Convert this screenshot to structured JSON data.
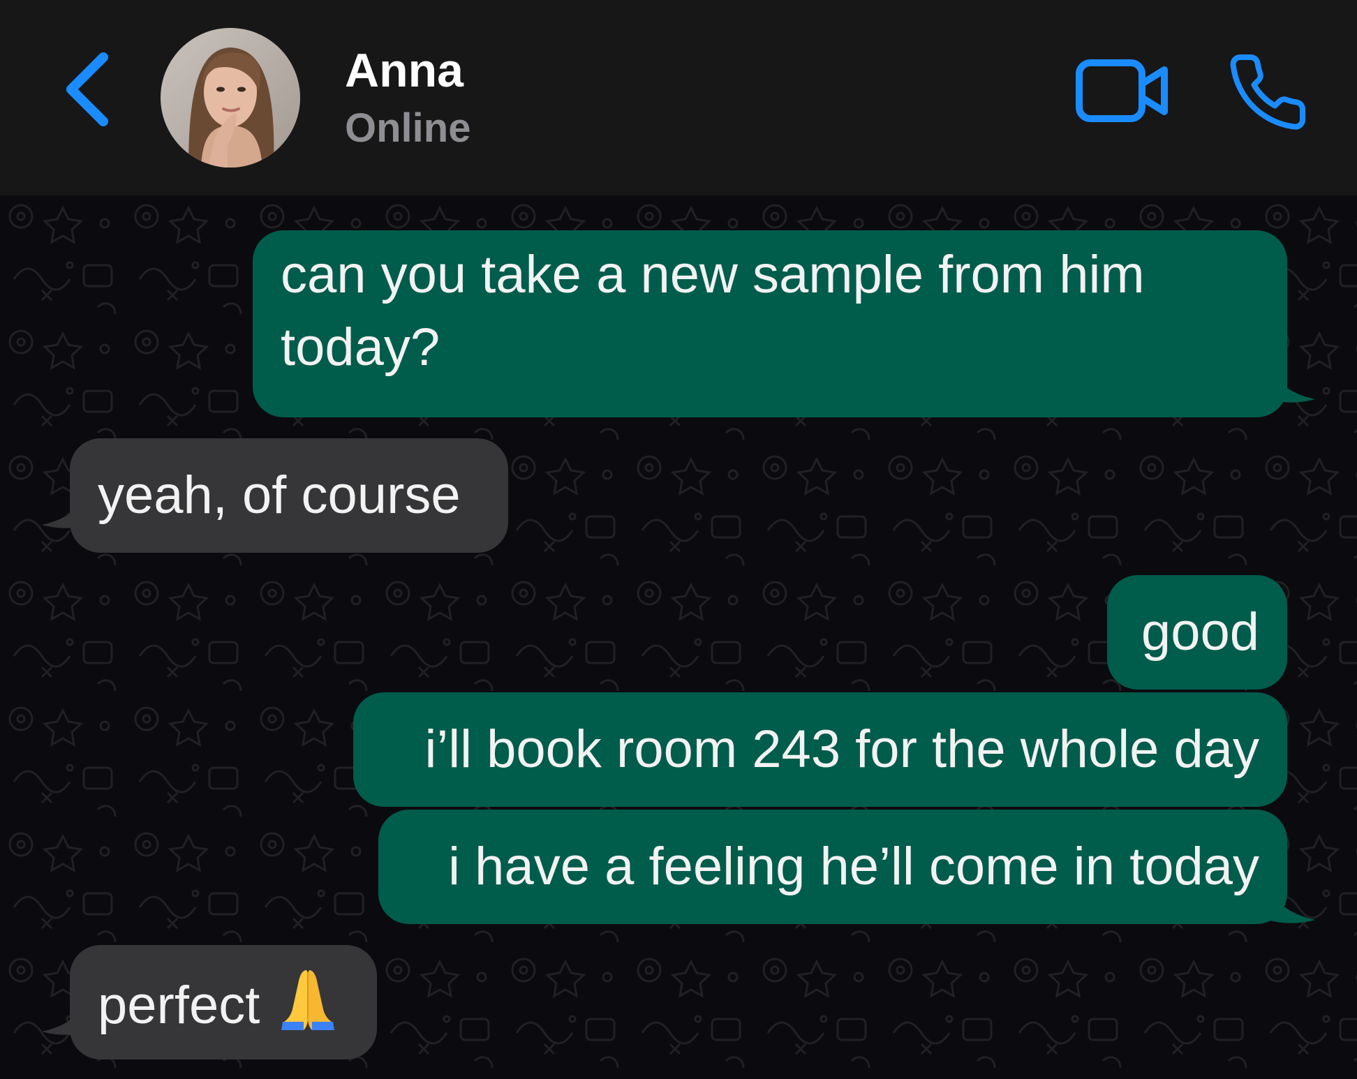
{
  "header": {
    "contact_name": "Anna",
    "status": "Online",
    "back_icon": "chevron-left-icon",
    "video_icon": "video-camera-icon",
    "call_icon": "phone-icon"
  },
  "colors": {
    "header_bg": "#171717",
    "accent": "#1a8cff",
    "outgoing_bubble": "#005c4b",
    "incoming_bubble": "#363638",
    "chat_bg": "#0b0b0f",
    "status_text": "#8e8e93"
  },
  "messages": [
    {
      "direction": "outgoing",
      "lines": [
        "can you take a new sample from him",
        "today?"
      ]
    },
    {
      "direction": "incoming",
      "text": "yeah, of course"
    },
    {
      "direction": "outgoing",
      "text": "good"
    },
    {
      "direction": "outgoing",
      "text": "i’ll book room 243 for the whole day"
    },
    {
      "direction": "outgoing",
      "text": "i have a feeling he’ll come in today"
    },
    {
      "direction": "incoming",
      "text": "perfect",
      "emoji": "folded-hands-emoji"
    }
  ]
}
